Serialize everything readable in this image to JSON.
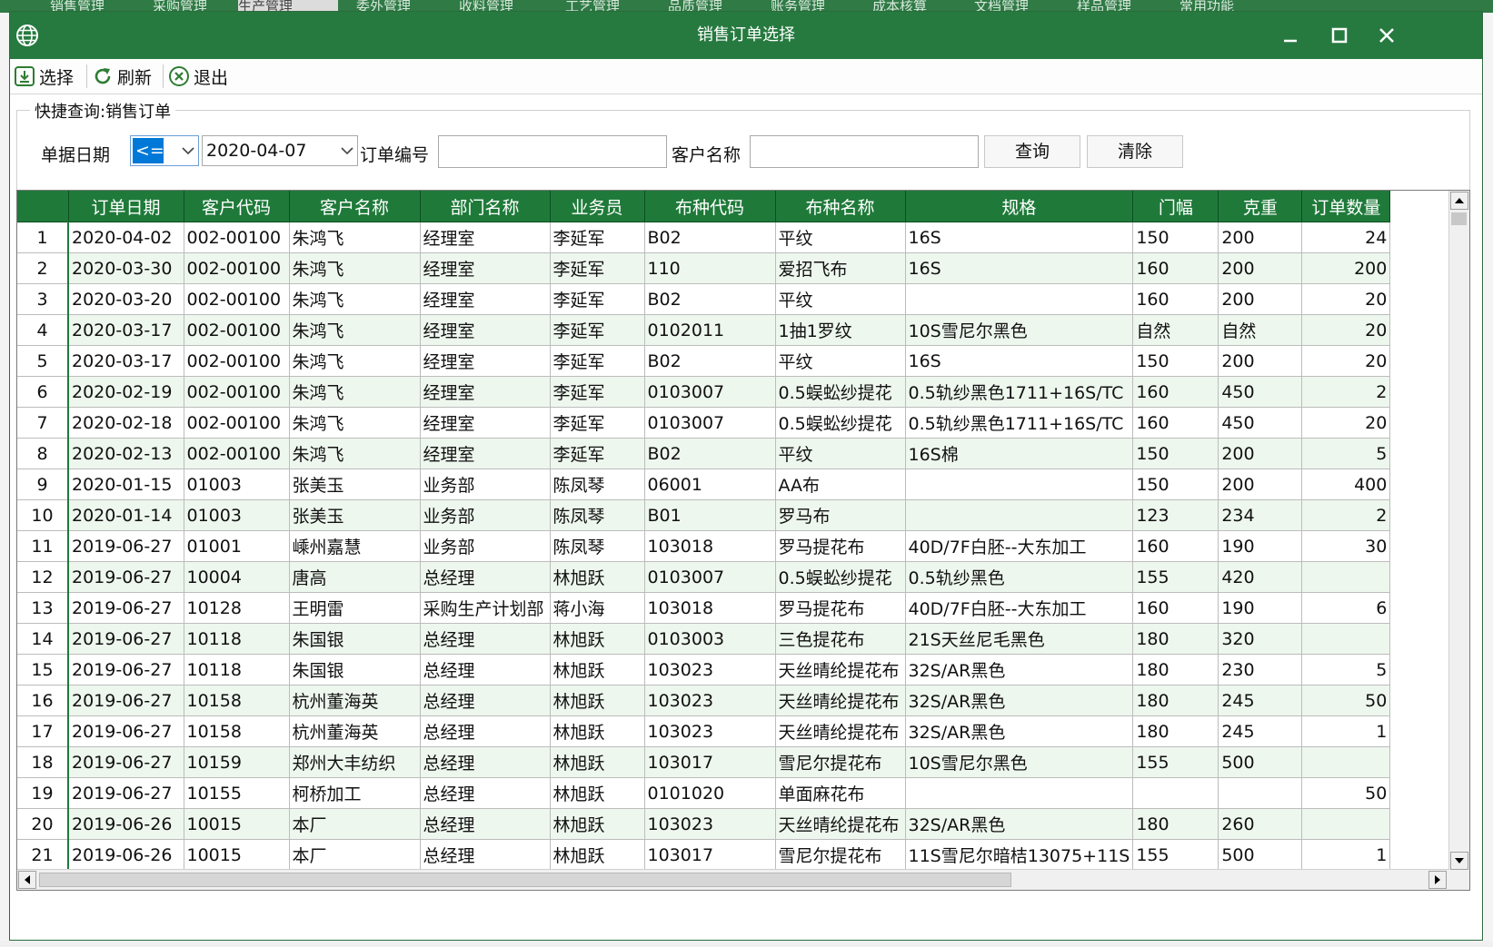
{
  "window": {
    "title": "销售订单选择",
    "minimize": "—",
    "maximize": "□",
    "close": "✕"
  },
  "background_tabs": [
    "销售管理",
    "采购管理",
    "生产管理",
    "委外管理",
    "收料管理",
    "工艺管理",
    "品质管理",
    "账务管理",
    "成本核算",
    "文档管理",
    "样品管理",
    "常用功能"
  ],
  "toolbar": {
    "select_label": "选择",
    "refresh_label": "刷新",
    "exit_label": "退出"
  },
  "query": {
    "group_title": "快捷查询:销售订单",
    "date_label": "单据日期",
    "date_operator": "<=",
    "date_value": "2020-04-07",
    "order_no_label": "订单编号",
    "order_no_value": "",
    "customer_label": "客户名称",
    "customer_value": "",
    "search_label": "查询",
    "clear_label": "清除"
  },
  "table": {
    "columns": [
      "订单日期",
      "客户代码",
      "客户名称",
      "部门名称",
      "业务员",
      "布种代码",
      "布种名称",
      "规格",
      "门幅",
      "克重",
      "订单数量"
    ],
    "rows": [
      [
        "1",
        "2020-04-02",
        "002-00100",
        "朱鸿飞",
        "经理室",
        "李延军",
        "B02",
        "平纹",
        "16S",
        "150",
        "200",
        "24"
      ],
      [
        "2",
        "2020-03-30",
        "002-00100",
        "朱鸿飞",
        "经理室",
        "李延军",
        "110",
        "爱招飞布",
        "16S",
        "160",
        "200",
        "200"
      ],
      [
        "3",
        "2020-03-20",
        "002-00100",
        "朱鸿飞",
        "经理室",
        "李延军",
        "B02",
        "平纹",
        "",
        "160",
        "200",
        "20"
      ],
      [
        "4",
        "2020-03-17",
        "002-00100",
        "朱鸿飞",
        "经理室",
        "李延军",
        "0102011",
        "1抽1罗纹",
        "10S雪尼尔黑色",
        "自然",
        "自然",
        "20"
      ],
      [
        "5",
        "2020-03-17",
        "002-00100",
        "朱鸿飞",
        "经理室",
        "李延军",
        "B02",
        "平纹",
        "16S",
        "150",
        "200",
        "20"
      ],
      [
        "6",
        "2020-02-19",
        "002-00100",
        "朱鸿飞",
        "经理室",
        "李延军",
        "0103007",
        "0.5蜈蚣纱提花",
        "0.5轨纱黑色1711+16S/TC",
        "160",
        "450",
        "2"
      ],
      [
        "7",
        "2020-02-18",
        "002-00100",
        "朱鸿飞",
        "经理室",
        "李延军",
        "0103007",
        "0.5蜈蚣纱提花",
        "0.5轨纱黑色1711+16S/TC",
        "160",
        "450",
        "20"
      ],
      [
        "8",
        "2020-02-13",
        "002-00100",
        "朱鸿飞",
        "经理室",
        "李延军",
        "B02",
        "平纹",
        "16S棉",
        "150",
        "200",
        "5"
      ],
      [
        "9",
        "2020-01-15",
        "01003",
        "张美玉",
        "业务部",
        "陈凤琴",
        "06001",
        "AA布",
        "",
        "150",
        "200",
        "400"
      ],
      [
        "10",
        "2020-01-14",
        "01003",
        "张美玉",
        "业务部",
        "陈凤琴",
        "B01",
        "罗马布",
        "",
        "123",
        "234",
        "2"
      ],
      [
        "11",
        "2019-06-27",
        "01001",
        "嵊州嘉慧",
        "业务部",
        "陈凤琴",
        "103018",
        "罗马提花布",
        "40D/7F白胚--大东加工",
        "160",
        "190",
        "30"
      ],
      [
        "12",
        "2019-06-27",
        "10004",
        "唐高",
        "总经理",
        "林旭跃",
        "0103007",
        "0.5蜈蚣纱提花",
        "0.5轨纱黑色",
        "155",
        "420",
        ""
      ],
      [
        "13",
        "2019-06-27",
        "10128",
        "王明雷",
        "采购生产计划部",
        "蒋小海",
        "103018",
        "罗马提花布",
        "40D/7F白胚--大东加工",
        "160",
        "190",
        "6"
      ],
      [
        "14",
        "2019-06-27",
        "10118",
        "朱国银",
        "总经理",
        "林旭跃",
        "0103003",
        "三色提花布",
        "21S天丝尼毛黑色",
        "180",
        "320",
        ""
      ],
      [
        "15",
        "2019-06-27",
        "10118",
        "朱国银",
        "总经理",
        "林旭跃",
        "103023",
        "天丝晴纶提花布",
        "32S/AR黑色",
        "180",
        "230",
        "5"
      ],
      [
        "16",
        "2019-06-27",
        "10158",
        "杭州董海英",
        "总经理",
        "林旭跃",
        "103023",
        "天丝晴纶提花布",
        "32S/AR黑色",
        "180",
        "245",
        "50"
      ],
      [
        "17",
        "2019-06-27",
        "10158",
        "杭州董海英",
        "总经理",
        "林旭跃",
        "103023",
        "天丝晴纶提花布",
        "32S/AR黑色",
        "180",
        "245",
        "1"
      ],
      [
        "18",
        "2019-06-27",
        "10159",
        "郑州大丰纺织",
        "总经理",
        "林旭跃",
        "103017",
        "雪尼尔提花布",
        "10S雪尼尔黑色",
        "155",
        "500",
        ""
      ],
      [
        "19",
        "2019-06-27",
        "10155",
        "柯桥加工",
        "总经理",
        "林旭跃",
        "0101020",
        "单面麻花布",
        "",
        "",
        "",
        "50"
      ],
      [
        "20",
        "2019-06-26",
        "10015",
        "本厂",
        "总经理",
        "林旭跃",
        "103023",
        "天丝晴纶提花布",
        "32S/AR黑色",
        "180",
        "260",
        ""
      ],
      [
        "21",
        "2019-06-26",
        "10015",
        "本厂",
        "总经理",
        "林旭跃",
        "103017",
        "雪尼尔提花布",
        "11S雪尼尔暗桔13075+11S",
        "155",
        "500",
        "1"
      ]
    ]
  },
  "colors": {
    "title_bar": "#267a3f",
    "header": "#1f7a3a",
    "row_alt": "#eef7ee",
    "selection": "#0078d7"
  }
}
